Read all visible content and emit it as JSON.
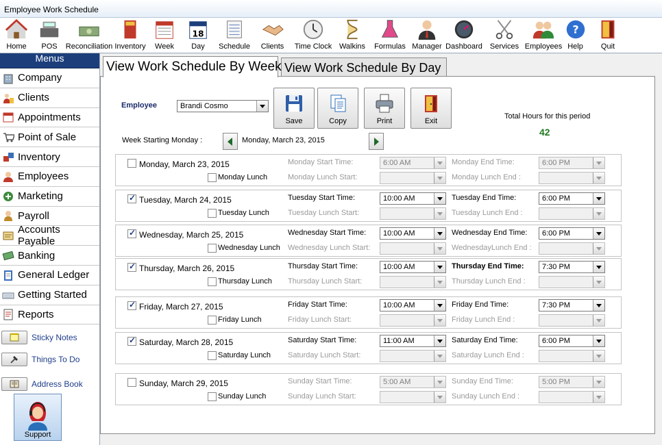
{
  "window": {
    "title": "Employee Work Schedule"
  },
  "toolbar": [
    {
      "label": "Home",
      "icon": "house-icon"
    },
    {
      "label": "POS",
      "icon": "cash-register-icon"
    },
    {
      "label": "Reconciliation",
      "icon": "money-stack-icon"
    },
    {
      "label": "Inventory",
      "icon": "book-icon"
    },
    {
      "label": "Week",
      "icon": "calendar-week-icon"
    },
    {
      "label": "Day",
      "icon": "calendar-day-icon"
    },
    {
      "label": "Schedule",
      "icon": "schedule-icon"
    },
    {
      "label": "Clients",
      "icon": "handshake-icon"
    },
    {
      "label": "Time Clock",
      "icon": "clock-icon"
    },
    {
      "label": "Walkins",
      "icon": "hourglass-icon"
    },
    {
      "label": "Formulas",
      "icon": "flask-icon"
    },
    {
      "label": "Manager",
      "icon": "manager-icon"
    },
    {
      "label": "Dashboard",
      "icon": "gauge-icon"
    },
    {
      "label": "Services",
      "icon": "scissors-icon"
    },
    {
      "label": "Employees",
      "icon": "people-icon"
    },
    {
      "label": "Help",
      "icon": "help-icon"
    },
    {
      "label": "Quit",
      "icon": "door-icon"
    }
  ],
  "sidebar": {
    "header": "Menus",
    "items": [
      {
        "label": "Company",
        "icon": "building-icon"
      },
      {
        "label": "Clients",
        "icon": "clients-icon"
      },
      {
        "label": "Appointments",
        "icon": "appointments-icon"
      },
      {
        "label": "Point of Sale",
        "icon": "cart-icon"
      },
      {
        "label": "Inventory",
        "icon": "boxes-icon"
      },
      {
        "label": "Employees",
        "icon": "employee-icon"
      },
      {
        "label": "Marketing",
        "icon": "marketing-icon"
      },
      {
        "label": "Payroll",
        "icon": "payroll-icon"
      },
      {
        "label": "Accounts Payable",
        "icon": "payable-icon"
      },
      {
        "label": "Banking",
        "icon": "banking-icon"
      },
      {
        "label": "General Ledger",
        "icon": "ledger-icon"
      },
      {
        "label": "Getting Started",
        "icon": "keyboard-icon"
      },
      {
        "label": "Reports",
        "icon": "report-icon"
      }
    ],
    "links": [
      {
        "label": "Sticky Notes",
        "icon": "sticky-note-icon"
      },
      {
        "label": "Things To Do",
        "icon": "hammer-icon"
      },
      {
        "label": "Address Book",
        "icon": "address-book-icon"
      }
    ],
    "support_label": "Support"
  },
  "tabs": {
    "week": "View Work Schedule By Week",
    "day": "View Work Schedule By Day"
  },
  "form": {
    "employee_label": "Employee",
    "employee_value": "Brandi Cosmo",
    "buttons": {
      "save": "Save",
      "copy": "Copy",
      "print": "Print",
      "exit": "Exit"
    },
    "total_label": "Total Hours for this period",
    "total_value": "42",
    "week_label": "Week Starting Monday :",
    "week_value": "Monday, March 23, 2015"
  },
  "days": [
    {
      "date": "Monday, March 23, 2015",
      "checked": false,
      "lunch": "Monday Lunch",
      "start_label": "Monday Start Time:",
      "start": "6:00 AM",
      "end_label": "Monday End Time:",
      "end": "6:00 PM",
      "lunch_start_label": "Monday Lunch Start:",
      "lunch_end_label": "Monday Lunch End :"
    },
    {
      "date": "Tuesday, March 24, 2015",
      "checked": true,
      "lunch": "Tuesday Lunch",
      "start_label": "Tuesday Start Time:",
      "start": "10:00 AM",
      "end_label": "Tuesday End Time:",
      "end": "6:00 PM",
      "lunch_start_label": "Tuesday Lunch Start:",
      "lunch_end_label": "Tuesday Lunch End :"
    },
    {
      "date": "Wednesday, March 25, 2015",
      "checked": true,
      "lunch": "Wednesday Lunch",
      "start_label": "Wednesday Start Time:",
      "start": "10:00 AM",
      "end_label": "Wednesday End Time:",
      "end": "6:00 PM",
      "lunch_start_label": "Wednesday Lunch Start:",
      "lunch_end_label": "WednesdayLunch End :"
    },
    {
      "date": "Thursday, March 26, 2015",
      "checked": true,
      "lunch": "Thursday Lunch",
      "start_label": "Thursday Start Time:",
      "start": "10:00 AM",
      "end_label": "Thursday End Time:",
      "end": "7:30 PM",
      "lunch_start_label": "Thursday Lunch Start:",
      "lunch_end_label": "Thursday Lunch End :"
    },
    {
      "date": "Friday, March 27, 2015",
      "checked": true,
      "lunch": "Friday Lunch",
      "start_label": "Friday Start Time:",
      "start": "10:00 AM",
      "end_label": "Friday End Time:",
      "end": "7:30 PM",
      "lunch_start_label": "Friday Lunch Start:",
      "lunch_end_label": "Friday Lunch End :"
    },
    {
      "date": "Saturday, March 28, 2015",
      "checked": true,
      "lunch": "Saturday Lunch",
      "start_label": "Saturday Start Time:",
      "start": "11:00 AM",
      "end_label": "Saturday End Time:",
      "end": "6:00 PM",
      "lunch_start_label": "Saturday Lunch Start:",
      "lunch_end_label": "Saturday Lunch End :"
    },
    {
      "date": "Sunday, March 29, 2015",
      "checked": false,
      "lunch": "Sunday Lunch",
      "start_label": "Sunday Start Time:",
      "start": "5:00 AM",
      "end_label": "Sunday End Time:",
      "end": "5:00 PM",
      "lunch_start_label": "Sunday Lunch Start:",
      "lunch_end_label": "Sunday Lunch End :"
    }
  ],
  "colors": {
    "accent": "#1c3f7c",
    "total": "#1f7a1f"
  }
}
